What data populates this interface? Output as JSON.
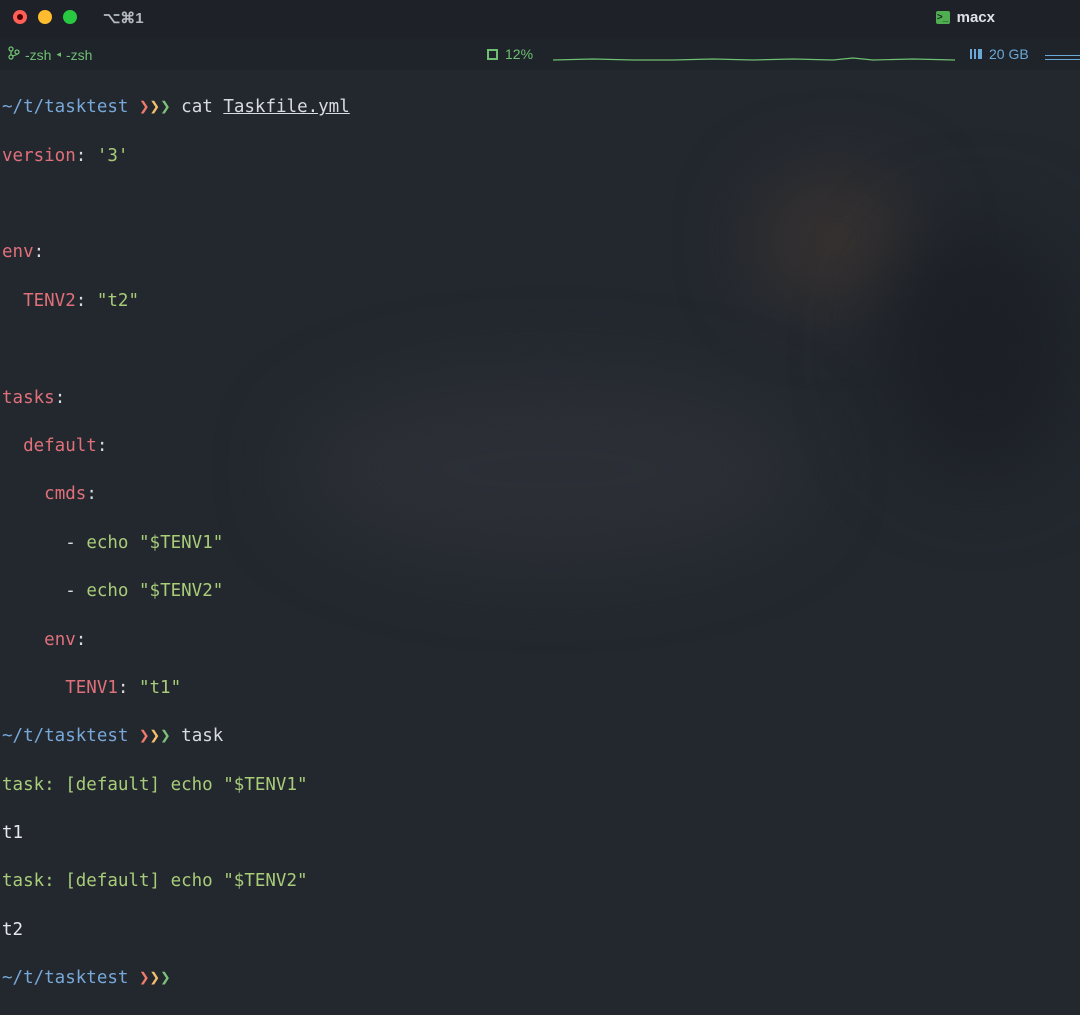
{
  "titlebar": {
    "shortcut": "⌥⌘1",
    "app_name": "macx",
    "app_icon": "terminal-prompt-icon"
  },
  "statusbar": {
    "tab1": "-zsh",
    "tab2": "-zsh",
    "cpu_label": "12%",
    "cpu_percent": 12,
    "mem_label": "20 GB",
    "accent_green": "#6fbf73",
    "accent_blue": "#6aa8d8"
  },
  "prompt": {
    "path": "~/t/tasktest",
    "chevrons": "❯❯❯"
  },
  "lines": {
    "cmd1": "cat",
    "cmd1_arg": "Taskfile.yml",
    "l_version_key": "version",
    "l_version_val": "'3'",
    "l_env_key": "env",
    "l_tenv2_key": "TENV2",
    "l_tenv2_val": "\"t2\"",
    "l_tasks_key": "tasks",
    "l_default_key": "default",
    "l_cmds_key": "cmds",
    "l_dash": "-",
    "l_echo1": "echo \"$TENV1\"",
    "l_echo2": "echo \"$TENV2\"",
    "l_env2_key": "env",
    "l_tenv1_key": "TENV1",
    "l_tenv1_val": "\"t1\"",
    "cmd2": "task",
    "out1": "task: [default] echo \"$TENV1\"",
    "out2": "t1",
    "out3": "task: [default] echo \"$TENV2\"",
    "out4": "t2"
  }
}
